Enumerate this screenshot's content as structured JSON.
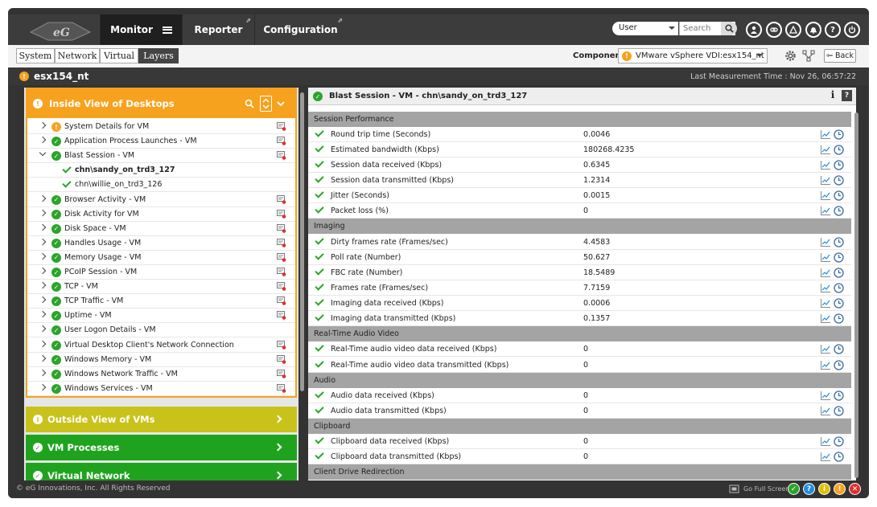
{
  "header": {
    "nav": [
      {
        "label": "Monitor"
      },
      {
        "label": "Reporter"
      },
      {
        "label": "Configuration"
      }
    ],
    "user_select": "User",
    "search_placeholder": "Search"
  },
  "subnav": {
    "tabs": [
      {
        "label": "System"
      },
      {
        "label": "Network"
      },
      {
        "label": "Virtual"
      },
      {
        "label": "Layers"
      }
    ],
    "active_tab": "Layers",
    "component_label": "Component",
    "component_value": "VMware vSphere VDI:esx154_nt",
    "back_label": "Back"
  },
  "titlebar": {
    "name": "esx154_nt",
    "last_measurement": "Last Measurement Time : Nov 26, 06:57:22"
  },
  "left": {
    "header_title": "Inside View of Desktops",
    "tree": [
      {
        "label": "System Details for VM",
        "status": "warn",
        "level": 0,
        "expanded": false
      },
      {
        "label": "Application Process Launches - VM",
        "status": "ok",
        "level": 0,
        "expanded": false
      },
      {
        "label": "Blast Session - VM",
        "status": "ok",
        "level": 0,
        "expanded": true
      },
      {
        "label": "chn\\sandy_on_trd3_127",
        "status": "check",
        "level": 1,
        "bold": true
      },
      {
        "label": "chn\\willie_on_trd3_126",
        "status": "check",
        "level": 1
      },
      {
        "label": "Browser Activity - VM",
        "status": "ok",
        "level": 0
      },
      {
        "label": "Disk Activity for VM",
        "status": "ok",
        "level": 0
      },
      {
        "label": "Disk Space - VM",
        "status": "ok",
        "level": 0
      },
      {
        "label": "Handles Usage - VM",
        "status": "ok",
        "level": 0
      },
      {
        "label": "Memory Usage - VM",
        "status": "ok",
        "level": 0
      },
      {
        "label": "PCoIP Session - VM",
        "status": "ok",
        "level": 0
      },
      {
        "label": "TCP - VM",
        "status": "ok",
        "level": 0
      },
      {
        "label": "TCP Traffic - VM",
        "status": "ok",
        "level": 0
      },
      {
        "label": "Uptime - VM",
        "status": "ok",
        "level": 0
      },
      {
        "label": "User Logon Details - VM",
        "status": "ok",
        "level": 0
      },
      {
        "label": "Virtual Desktop Client's Network Connection",
        "status": "ok",
        "level": 0
      },
      {
        "label": "Windows Memory - VM",
        "status": "ok",
        "level": 0
      },
      {
        "label": "Windows Network Traffic - VM",
        "status": "ok",
        "level": 0
      },
      {
        "label": "Windows Services - VM",
        "status": "ok",
        "level": 0
      }
    ],
    "panels": [
      {
        "label": "Outside View of VMs",
        "color": "#c9c21a",
        "icon": "i"
      },
      {
        "label": "VM Processes",
        "color": "#1fa31f",
        "icon": "✓"
      },
      {
        "label": "Virtual Network",
        "color": "#1fa31f",
        "icon": "✓"
      }
    ]
  },
  "right": {
    "header_title": "Blast Session - VM - chn\\sandy_on_trd3_127",
    "sections": [
      {
        "title": "Session Performance",
        "rows": [
          {
            "name": "Round trip time (Seconds)",
            "value": "0.0046"
          },
          {
            "name": "Estimated bandwidth (Kbps)",
            "value": "180268.4235"
          },
          {
            "name": "Session data received (Kbps)",
            "value": "0.6345"
          },
          {
            "name": "Session data transmitted (Kbps)",
            "value": "1.2314"
          },
          {
            "name": "Jitter (Seconds)",
            "value": "0.0015"
          },
          {
            "name": "Packet loss (%)",
            "value": "0"
          }
        ]
      },
      {
        "title": "Imaging",
        "rows": [
          {
            "name": "Dirty frames rate (Frames/sec)",
            "value": "4.4583"
          },
          {
            "name": "Poll rate (Number)",
            "value": "50.627"
          },
          {
            "name": "FBC rate (Number)",
            "value": "18.5489"
          },
          {
            "name": "Frames rate (Frames/sec)",
            "value": "7.7159"
          },
          {
            "name": "Imaging data received (Kbps)",
            "value": "0.0006"
          },
          {
            "name": "Imaging data transmitted (Kbps)",
            "value": "0.1357"
          }
        ]
      },
      {
        "title": "Real-Time Audio Video",
        "rows": [
          {
            "name": "Real-Time audio video data received (Kbps)",
            "value": "0"
          },
          {
            "name": "Real-Time audio video data transmitted (Kbps)",
            "value": "0"
          }
        ]
      },
      {
        "title": "Audio",
        "rows": [
          {
            "name": "Audio data received (Kbps)",
            "value": "0"
          },
          {
            "name": "Audio data transmitted (Kbps)",
            "value": "0"
          }
        ]
      },
      {
        "title": "Clipboard",
        "rows": [
          {
            "name": "Clipboard data received (Kbps)",
            "value": "0"
          },
          {
            "name": "Clipboard data transmitted (Kbps)",
            "value": "0"
          }
        ]
      },
      {
        "title": "Client Drive Redirection",
        "rows": []
      }
    ]
  },
  "footer": {
    "copyright": "© eG Innovations, Inc. All Rights Reserved",
    "full_screen": "Go Full Screen"
  },
  "colors": {
    "accent": "#f7a21e",
    "ok": "#2aa52a",
    "header": "#3c3c3c"
  }
}
